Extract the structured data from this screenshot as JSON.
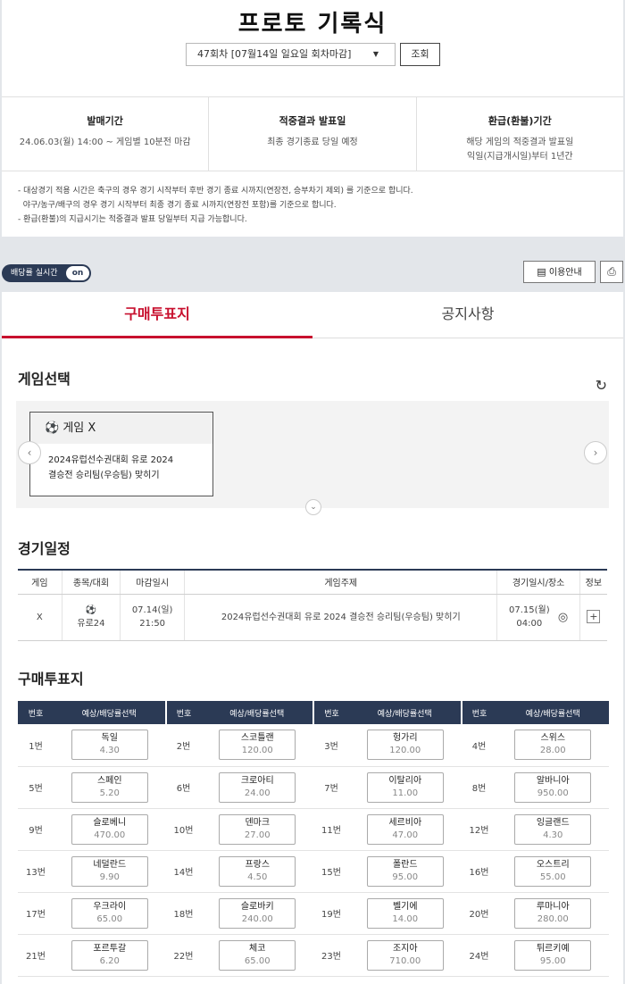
{
  "header": {
    "title": "프로토 기록식",
    "round_select": "47회차 [07월14일 일요일 회차마감]",
    "query_btn": "조회"
  },
  "info": [
    {
      "head": "발매기간",
      "lines": [
        "24.06.03(월) 14:00 ~ 게임별 10분전 마감"
      ]
    },
    {
      "head": "적중결과 발표일",
      "lines": [
        "최종 경기종료 당일 예정"
      ]
    },
    {
      "head": "환급(환불)기간",
      "lines": [
        "해당 게임의 적중결과 발표일",
        "익일(지급개시일)부터 1년간"
      ]
    }
  ],
  "notes": [
    "- 대상경기 적용 시간은 축구의 경우 경기 시작부터 후반 경기 종료 시까지(연장전, 승부차기 제외) 를 기준으로 합니다.",
    "  야구/농구/배구의 경우 경기 시작부터 최종 경기 종료 시까지(연장전 포함)를 기준으로 합니다.",
    "- 환급(환불)의 지급시기는 적중결과 발표 당일부터 지급 가능합니다."
  ],
  "toolbar": {
    "realtime_label": "배당률 실시간",
    "realtime_state": "on",
    "guide_btn": "이용안내"
  },
  "tabs": [
    "구매투표지",
    "공지사항"
  ],
  "game_select": {
    "title": "게임선택",
    "card_head": "게임 X",
    "card_lines": [
      "2024유럽선수권대회 유로 2024",
      "결승전 승리팀(우승팀) 맞히기"
    ]
  },
  "schedule": {
    "title": "경기일정",
    "headers": [
      "게임",
      "종목/대회",
      "마감일시",
      "게임주제",
      "경기일시/장소",
      "정보"
    ],
    "row": {
      "game": "X",
      "league": "유로24",
      "close_date": "07.14(일)",
      "close_time": "21:50",
      "subject": "2024유럽선수권대회 유로 2024 결승전 승리팀(우승팀) 맞히기",
      "match_date": "07.15(월)",
      "match_time": "04:00"
    }
  },
  "ballot": {
    "title": "구매투표지",
    "col_no": "번호",
    "col_pick": "예상/배당률선택",
    "picks": [
      {
        "no": "1번",
        "team": "독일",
        "odds": "4.30"
      },
      {
        "no": "2번",
        "team": "스코틀랜",
        "odds": "120.00"
      },
      {
        "no": "3번",
        "team": "헝가리",
        "odds": "120.00"
      },
      {
        "no": "4번",
        "team": "스위스",
        "odds": "28.00"
      },
      {
        "no": "5번",
        "team": "스페인",
        "odds": "5.20"
      },
      {
        "no": "6번",
        "team": "크로아티",
        "odds": "24.00"
      },
      {
        "no": "7번",
        "team": "이탈리아",
        "odds": "11.00"
      },
      {
        "no": "8번",
        "team": "알바니아",
        "odds": "950.00"
      },
      {
        "no": "9번",
        "team": "슬로베니",
        "odds": "470.00"
      },
      {
        "no": "10번",
        "team": "덴마크",
        "odds": "27.00"
      },
      {
        "no": "11번",
        "team": "세르비아",
        "odds": "47.00"
      },
      {
        "no": "12번",
        "team": "잉글랜드",
        "odds": "4.30"
      },
      {
        "no": "13번",
        "team": "네덜란드",
        "odds": "9.90"
      },
      {
        "no": "14번",
        "team": "프랑스",
        "odds": "4.50"
      },
      {
        "no": "15번",
        "team": "폴란드",
        "odds": "95.00"
      },
      {
        "no": "16번",
        "team": "오스트리",
        "odds": "55.00"
      },
      {
        "no": "17번",
        "team": "우크라이",
        "odds": "65.00"
      },
      {
        "no": "18번",
        "team": "슬로바키",
        "odds": "240.00"
      },
      {
        "no": "19번",
        "team": "벨기에",
        "odds": "14.00"
      },
      {
        "no": "20번",
        "team": "루마니아",
        "odds": "280.00"
      },
      {
        "no": "21번",
        "team": "포르투갈",
        "odds": "6.20"
      },
      {
        "no": "22번",
        "team": "체코",
        "odds": "65.00"
      },
      {
        "no": "23번",
        "team": "조지아",
        "odds": "710.00"
      },
      {
        "no": "24번",
        "team": "튀르키예",
        "odds": "95.00"
      }
    ]
  }
}
